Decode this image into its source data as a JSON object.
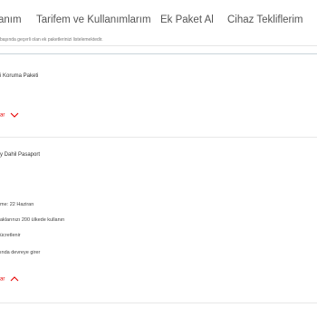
{
  "nav": {
    "items": [
      {
        "label": "anım"
      },
      {
        "label": "Tarifem ve Kullanımlarım"
      },
      {
        "label": "Ek Paket Al"
      },
      {
        "label": "Cihaz Tekliflerim"
      }
    ]
  },
  "notice": {
    "text": "başında geçerli olan ek paketlerinizi listelemektedir."
  },
  "packages": [
    {
      "title": "i Koruma Paketi",
      "toggle_label": "ar",
      "expanded": false
    },
    {
      "title": "y Dahil Pasaport",
      "details": [
        "me: 22 Haziran",
        "aklarınızı 200 ülkede kullanın",
        "ücretlenir",
        "ında devreye girer"
      ],
      "toggle_label": "ar",
      "expanded": true
    }
  ],
  "colors": {
    "accent": "#e60000",
    "text": "#333333",
    "divider": "#e8e8e8"
  },
  "icons": {
    "collapsed": "chevron-down-icon",
    "expanded": "chevron-up-icon"
  }
}
